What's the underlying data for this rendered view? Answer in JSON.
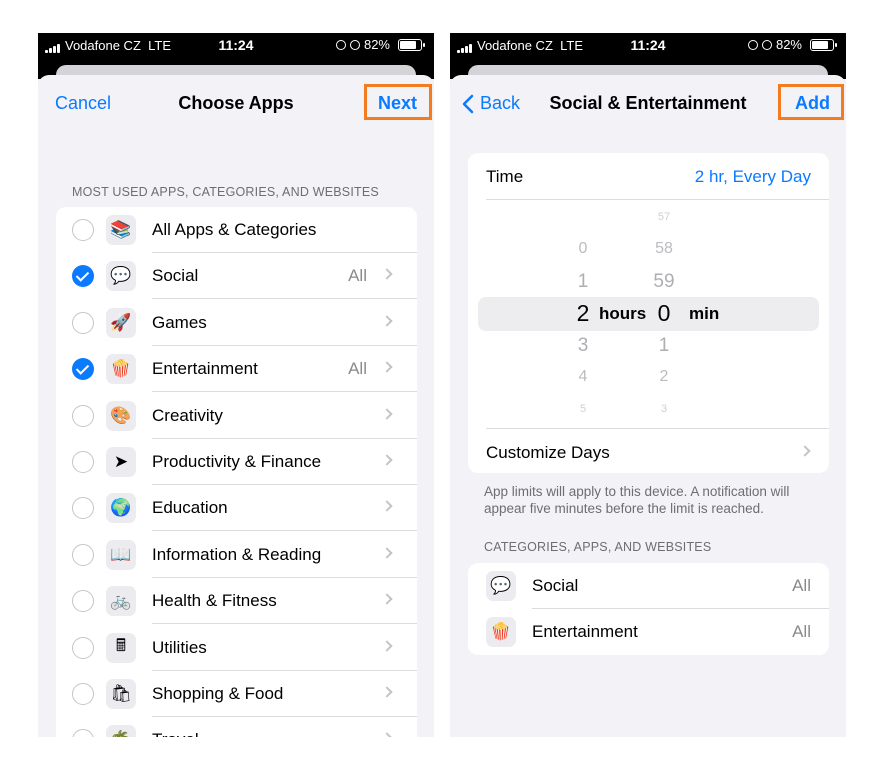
{
  "status_bar": {
    "carrier": "Vodafone CZ",
    "network": "LTE",
    "time": "11:24",
    "battery": "82%"
  },
  "accent_color": "#0a7aff",
  "highlight_color": "#f47c20",
  "choose_apps": {
    "cancel_label": "Cancel",
    "title": "Choose Apps",
    "next_label": "Next",
    "section_header": "MOST USED APPS, CATEGORIES, AND WEBSITES",
    "items": [
      {
        "label": "All Apps & Categories",
        "icon": "stack-icon",
        "checked": false,
        "detail": "",
        "chevron": false
      },
      {
        "label": "Social",
        "icon": "speech-bubble-icon",
        "checked": true,
        "detail": "All",
        "chevron": true
      },
      {
        "label": "Games",
        "icon": "rocket-icon",
        "checked": false,
        "detail": "",
        "chevron": true
      },
      {
        "label": "Entertainment",
        "icon": "popcorn-icon",
        "checked": true,
        "detail": "All",
        "chevron": true
      },
      {
        "label": "Creativity",
        "icon": "palette-icon",
        "checked": false,
        "detail": "",
        "chevron": true
      },
      {
        "label": "Productivity & Finance",
        "icon": "paper-plane-icon",
        "checked": false,
        "detail": "",
        "chevron": true
      },
      {
        "label": "Education",
        "icon": "globe-icon",
        "checked": false,
        "detail": "",
        "chevron": true
      },
      {
        "label": "Information & Reading",
        "icon": "book-icon",
        "checked": false,
        "detail": "",
        "chevron": true
      },
      {
        "label": "Health & Fitness",
        "icon": "bicycle-icon",
        "checked": false,
        "detail": "",
        "chevron": true
      },
      {
        "label": "Utilities",
        "icon": "calculator-icon",
        "checked": false,
        "detail": "",
        "chevron": true
      },
      {
        "label": "Shopping & Food",
        "icon": "shopping-bag-icon",
        "checked": false,
        "detail": "",
        "chevron": true
      },
      {
        "label": "Travel",
        "icon": "palm-tree-icon",
        "checked": false,
        "detail": "",
        "chevron": true
      }
    ]
  },
  "social_entertainment": {
    "back_label": "Back",
    "title": "Social & Entertainment",
    "add_label": "Add",
    "time_label": "Time",
    "time_value": "2 hr, Every Day",
    "picker": {
      "hours": [
        "0",
        "1",
        "2",
        "3",
        "4",
        "5"
      ],
      "selected_hours": "2",
      "hours_unit": "hours",
      "minutes": [
        "57",
        "58",
        "59",
        "0",
        "1",
        "2",
        "3"
      ],
      "selected_minutes": "0",
      "minutes_unit": "min"
    },
    "customize_days_label": "Customize Days",
    "note": "App limits will apply to this device. A notification will appear five minutes before the limit is reached.",
    "section_header": "CATEGORIES, APPS, AND WEBSITES",
    "categories": [
      {
        "label": "Social",
        "icon": "speech-bubble-icon",
        "detail": "All"
      },
      {
        "label": "Entertainment",
        "icon": "popcorn-icon",
        "detail": "All"
      }
    ]
  }
}
